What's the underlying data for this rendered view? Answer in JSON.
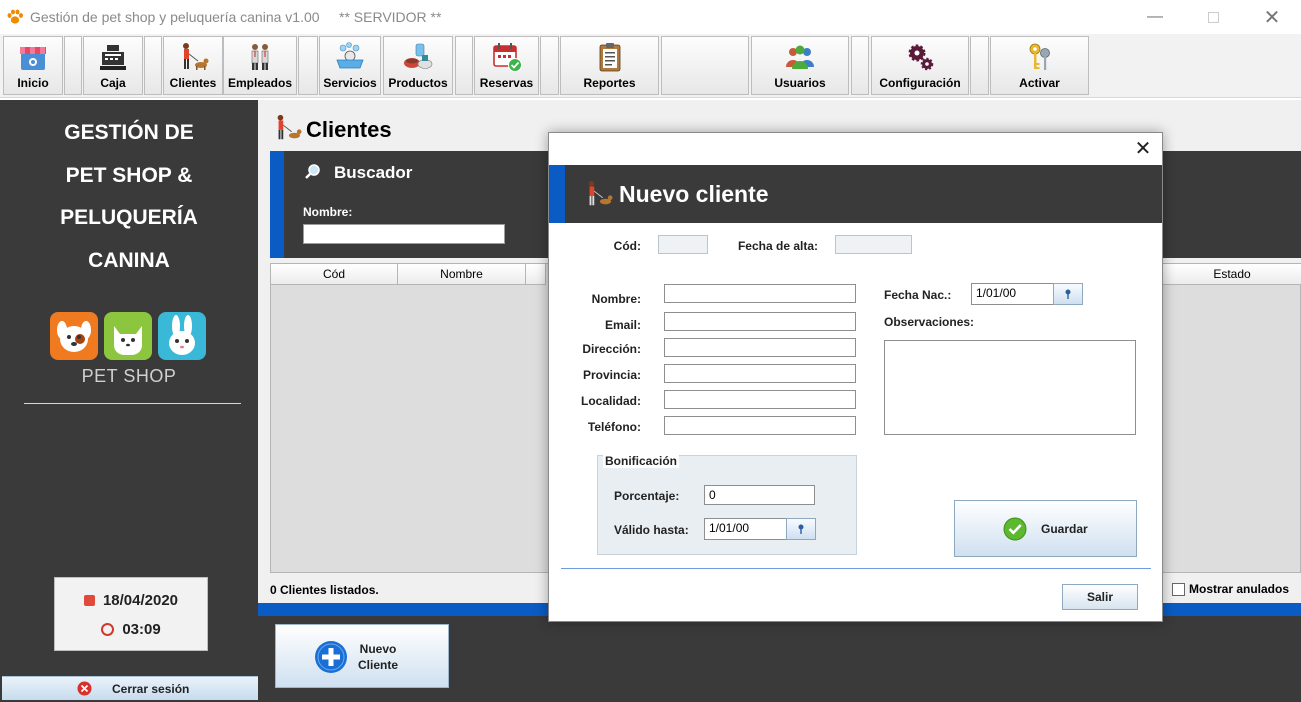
{
  "window": {
    "title": "Gestión de pet shop y peluquería canina v1.00",
    "server_tag": "** SERVIDOR **"
  },
  "toolbar": {
    "items": [
      {
        "label": "Inicio",
        "icon": "shop-icon"
      },
      {
        "label": "Caja",
        "icon": "cash-register-icon"
      },
      {
        "label": "Clientes",
        "icon": "person-walking-dog-icon"
      },
      {
        "label": "Empleados",
        "icon": "employees-icon"
      },
      {
        "label": "Servicios",
        "icon": "dog-bath-icon"
      },
      {
        "label": "Productos",
        "icon": "products-icon"
      },
      {
        "label": "Reservas",
        "icon": "calendar-check-icon"
      },
      {
        "label": "Reportes",
        "icon": "clipboard-icon"
      },
      {
        "label": "Usuarios",
        "icon": "users-icon"
      },
      {
        "label": "Configuración",
        "icon": "gears-icon"
      },
      {
        "label": "Activar",
        "icon": "keys-icon"
      }
    ]
  },
  "sidebar": {
    "brand_lines": [
      "GESTIÓN DE",
      "PET SHOP &",
      "PELUQUERÍA",
      "CANINA"
    ],
    "logo_text": "PET SHOP",
    "date": "18/04/2020",
    "time": "03:09",
    "logout_label": "Cerrar sesión"
  },
  "main": {
    "title": "Clientes",
    "search_title": "Buscador",
    "name_label": "Nombre:",
    "columns": [
      "Cód",
      "Nombre",
      "Estado"
    ],
    "count_text": "0 Clientes listados.",
    "show_void_label": "Mostrar anulados",
    "new_button_line1": "Nuevo",
    "new_button_line2": "Cliente"
  },
  "dialog": {
    "title": "Nuevo cliente",
    "cod_label": "Cód:",
    "alta_label": "Fecha de alta:",
    "fields": {
      "nombre": "Nombre:",
      "email": "Email:",
      "direccion": "Dirección:",
      "provincia": "Provincia:",
      "localidad": "Localidad:",
      "telefono": "Teléfono:"
    },
    "fecha_nac_label": "Fecha Nac.:",
    "fecha_nac_value": "1/01/00",
    "observaciones_label": "Observaciones:",
    "bonificacion": {
      "legend": "Bonificación",
      "porcentaje_label": "Porcentaje:",
      "porcentaje_value": "0",
      "valido_label": "Válido hasta:",
      "valido_value": "1/01/00"
    },
    "save_label": "Guardar",
    "exit_label": "Salir"
  },
  "colors": {
    "accent_blue": "#0a5bc4",
    "dark_panel": "#3a3a3a",
    "save_green": "#5cb82e"
  }
}
